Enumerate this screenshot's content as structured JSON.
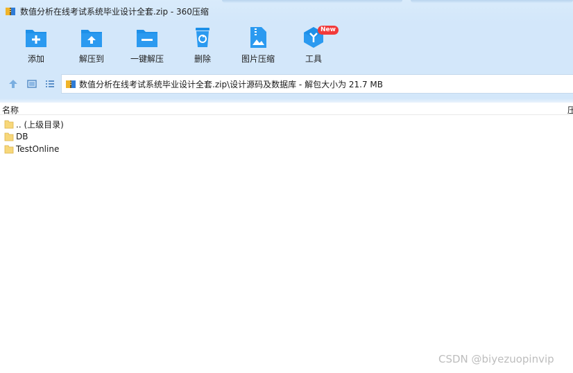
{
  "window": {
    "title": "数值分析在线考试系统毕业设计全套.zip - 360压缩"
  },
  "toolbar": {
    "items": [
      {
        "label": "添加",
        "icon": "add-icon"
      },
      {
        "label": "解压到",
        "icon": "extract-to-icon"
      },
      {
        "label": "一键解压",
        "icon": "one-click-extract-icon"
      },
      {
        "label": "删除",
        "icon": "delete-icon"
      },
      {
        "label": "图片压缩",
        "icon": "image-compress-icon"
      },
      {
        "label": "工具",
        "icon": "tools-icon",
        "badge": "New"
      }
    ]
  },
  "address": {
    "path": "数值分析在线考试系统毕业设计全套.zip\\设计源码及数据库 - 解包大小为 21.7 MB"
  },
  "list": {
    "columns": {
      "name": "名称",
      "size": "压"
    },
    "rows": [
      {
        "name": ".. (上级目录)"
      },
      {
        "name": "DB"
      },
      {
        "name": "TestOnline"
      }
    ]
  },
  "watermark": "CSDN @biyezuopinvip",
  "colors": {
    "accent": "#1e90e8",
    "toolbar_bg": "#d3e7fa",
    "badge": "#f23a3a",
    "folder": "#f7d77a"
  }
}
